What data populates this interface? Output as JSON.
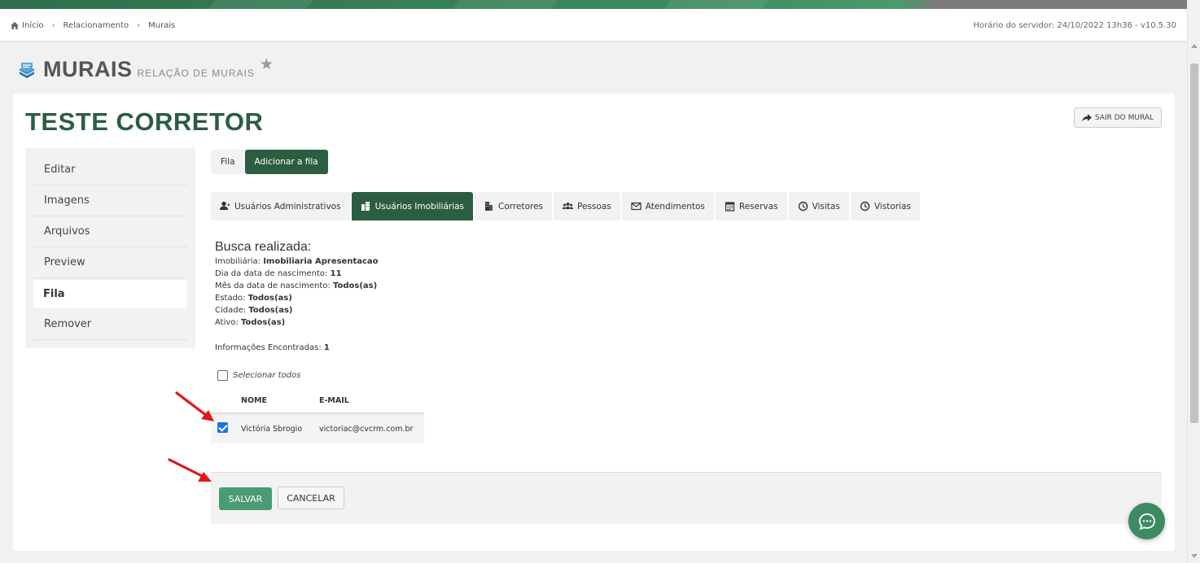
{
  "breadcrumb": {
    "items": [
      "Início",
      "Relacionamento",
      "Murais"
    ]
  },
  "server_time": "Horário do servidor: 24/10/2022 13h36 - v10.5.30",
  "page": {
    "title": "MURAIS",
    "subtitle": "RELAÇÃO DE MURAIS"
  },
  "card": {
    "title": "TESTE CORRETOR",
    "exit_label": "SAIR DO MURAL"
  },
  "sidemenu": {
    "items": [
      "Editar",
      "Imagens",
      "Arquivos",
      "Preview",
      "Fila",
      "Remover"
    ],
    "active": "Fila"
  },
  "subtabs": {
    "items": [
      "Fila",
      "Adicionar a fila"
    ],
    "active": "Adicionar a fila"
  },
  "tabs": {
    "items": [
      {
        "label": "Usuários Administrativos",
        "icon": "user-arrow-icon"
      },
      {
        "label": "Usuários Imobiliárias",
        "icon": "buildings-icon"
      },
      {
        "label": "Corretores",
        "icon": "building-icon"
      },
      {
        "label": "Pessoas",
        "icon": "group-icon"
      },
      {
        "label": "Atendimentos",
        "icon": "envelope-icon"
      },
      {
        "label": "Reservas",
        "icon": "calendar-icon"
      },
      {
        "label": "Visitas",
        "icon": "clock-icon"
      },
      {
        "label": "Vistorias",
        "icon": "clock-icon"
      }
    ],
    "active": "Usuários Imobiliárias"
  },
  "search": {
    "heading": "Busca realizada:",
    "filters": [
      {
        "label": "Imobiliária:",
        "value": "Imobiliaria Apresentacao"
      },
      {
        "label": "Dia da data de nascimento:",
        "value": "11"
      },
      {
        "label": "Mês da data de nascimento:",
        "value": "Todos(as)"
      },
      {
        "label": "Estado:",
        "value": "Todos(as)"
      },
      {
        "label": "Cidade:",
        "value": "Todos(as)"
      },
      {
        "label": "Ativo:",
        "value": "Todos(as)"
      }
    ],
    "found_label": "Informações Encontradas:",
    "found_value": "1"
  },
  "select_all_label": "Selecionar todos",
  "table": {
    "headers": [
      "NOME",
      "E-MAIL"
    ],
    "rows": [
      {
        "name": "Victória Sbrogio",
        "email": "victoriac@cvcrm.com.br",
        "checked": true
      }
    ]
  },
  "footer": {
    "save_label": "SALVAR",
    "cancel_label": "CANCELAR"
  },
  "colors": {
    "primary_green": "#2b5e41",
    "save_green": "#4a9a73",
    "chat_green": "#3d8a63",
    "arrow_red": "#e3151a",
    "checkbox_blue": "#1a73e8"
  }
}
